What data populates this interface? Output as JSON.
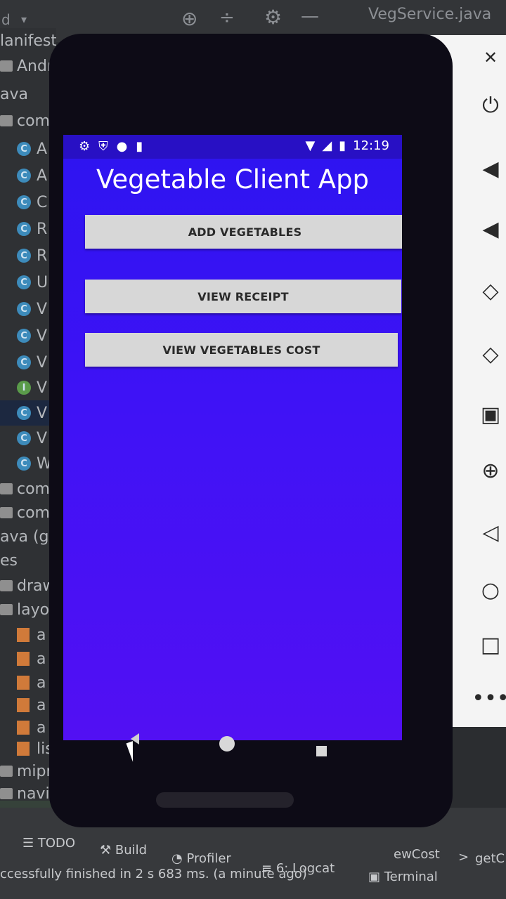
{
  "ide": {
    "file_tab": "VegService.java",
    "left_fragments": [
      "d",
      "lanifests",
      "Andr",
      "ava",
      "com"
    ],
    "tree_rows": [
      {
        "icon": "class-icon",
        "label": "A"
      },
      {
        "icon": "class-icon",
        "label": "A"
      },
      {
        "icon": "class-icon",
        "label": "C"
      },
      {
        "icon": "class-icon",
        "label": "R"
      },
      {
        "icon": "class-icon",
        "label": "R"
      },
      {
        "icon": "class-icon",
        "label": "U"
      },
      {
        "icon": "class-icon",
        "label": "V"
      },
      {
        "icon": "class-icon",
        "label": "V"
      },
      {
        "icon": "class-icon",
        "label": "V"
      },
      {
        "icon": "interface-icon",
        "label": "V"
      },
      {
        "icon": "class-icon",
        "label": "V"
      },
      {
        "icon": "class-icon",
        "label": "V"
      },
      {
        "icon": "class-icon",
        "label": "W"
      }
    ],
    "lower_rows": [
      "com",
      "com",
      "ava (ge",
      "es",
      "draw",
      "layo",
      "a",
      "a",
      "a",
      "a",
      "a",
      "lis",
      "mipr",
      "navi"
    ],
    "status_left": "uccessfu",
    "bottom_tabs": {
      "todo": "TODO",
      "build": "Build",
      "profiler": "Profiler",
      "logcat": "6: Logcat",
      "terminal": "Terminal",
      "breadcrumb_1": "ewCost",
      "breadcrumb_sep": ">",
      "breadcrumb_2": "getC"
    },
    "status_message": "ccessfully finished in 2 s 683 ms. (a minute ago)"
  },
  "phone": {
    "status_time": "12:19",
    "app_title": "Vegetable Client App",
    "buttons": {
      "add": "ADD VEGETABLES",
      "receipt": "VIEW RECEIPT",
      "cost": "VIEW VEGETABLES COST"
    }
  },
  "colors": {
    "screen_top": "#2d14f0",
    "screen_bottom": "#5210f3",
    "button": "#d7d7d7"
  }
}
